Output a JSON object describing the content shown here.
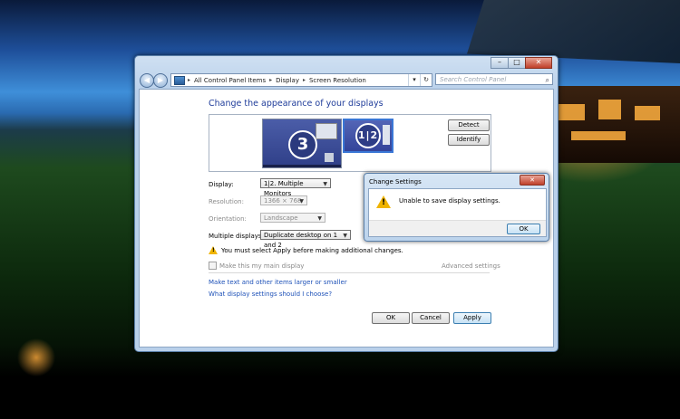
{
  "window": {
    "breadcrumb": [
      "All Control Panel Items",
      "Display",
      "Screen Resolution"
    ],
    "search_placeholder": "Search Control Panel",
    "heading": "Change the appearance of your displays",
    "monitors": {
      "left_label": "3",
      "right_label": "1|2"
    },
    "detect_label": "Detect",
    "identify_label": "Identify",
    "fields": {
      "display_label": "Display:",
      "display_value": "1|2. Multiple Monitors",
      "resolution_label": "Resolution:",
      "resolution_value": "1366 × 768",
      "orientation_label": "Orientation:",
      "orientation_value": "Landscape",
      "multiple_label": "Multiple displays:",
      "multiple_value": "Duplicate desktop on 1 and 2"
    },
    "warning": "You must select Apply before making additional changes.",
    "main_display_checkbox": "Make this my main display",
    "advanced_link": "Advanced settings",
    "links": [
      "Make text and other items larger or smaller",
      "What display settings should I choose?"
    ],
    "buttons": {
      "ok": "OK",
      "cancel": "Cancel",
      "apply": "Apply"
    }
  },
  "dialog": {
    "title": "Change Settings",
    "message": "Unable to save display settings.",
    "ok": "OK"
  }
}
